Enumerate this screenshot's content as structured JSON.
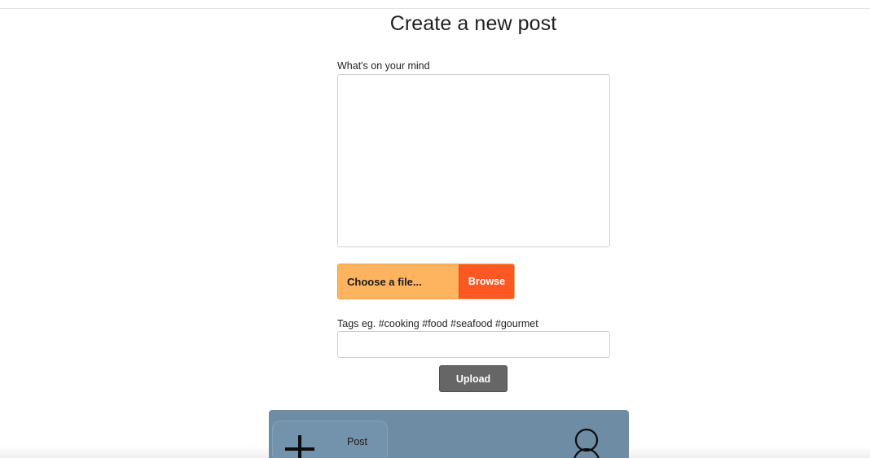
{
  "page": {
    "title": "Create a new post"
  },
  "form": {
    "message_label": "What's on your mind",
    "message_value": "",
    "file_choose_label": "Choose a file...",
    "file_browse_label": "Browse",
    "tags_label": "Tags eg. #cooking #food #seafood #gourmet",
    "tags_value": "",
    "upload_label": "Upload"
  },
  "bottom_nav": {
    "post_label": "Post",
    "post_icon": "plus-icon",
    "profile_icon": "user-icon"
  },
  "colors": {
    "file_choose_bg": "#feb45f",
    "file_browse_bg": "#fd5724",
    "upload_bg": "#666666",
    "nav_bg": "#6f8ca5"
  }
}
